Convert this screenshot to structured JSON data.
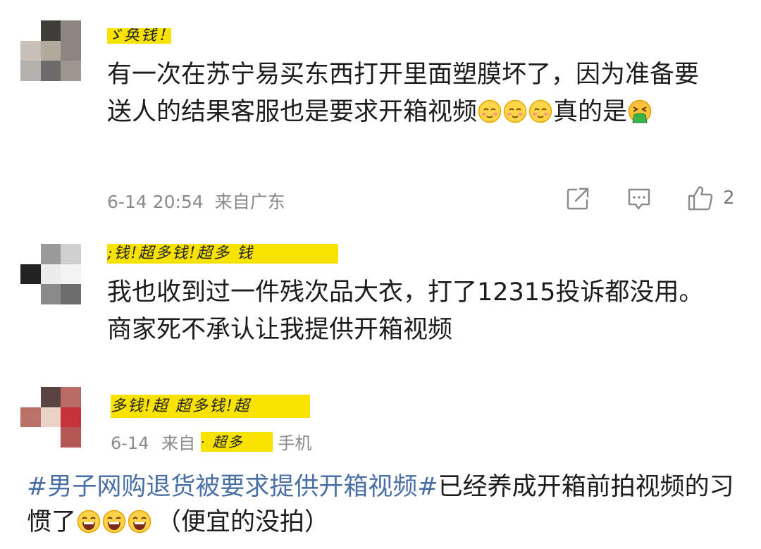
{
  "comments": [
    {
      "avatar_colors": [
        "#ffffff",
        "#3f3e3b",
        "#8f8580",
        "#c9bfb6",
        "#b3aa9e",
        "#8f8580",
        "#b4b0ad",
        "#6c6a6a",
        "#a1968f"
      ],
      "text": "有一次在苏宁易买东西打开里面塑膜坏了，因为准备要送人的结果客服也是要求开箱视频",
      "text_tail": "真的是",
      "timestamp": "6-14 20:54",
      "location": "来自广东",
      "like_count": "2",
      "emoji_after_text": [
        "blushing-face",
        "blushing-face",
        "blushing-face"
      ],
      "emoji_end": "vomiting-face"
    },
    {
      "avatar_colors": [
        "#ffffff",
        "#9a9a9a",
        "#cfcfcf",
        "#222222",
        "#ececec",
        "#f3f3f3",
        "#ffffff",
        "#8a8a8a",
        "#6d6d6d"
      ],
      "text": "我也收到过一件残次品大衣，打了12315投诉都没用。商家死不承认让我提供开箱视频"
    },
    {
      "avatar_colors": [
        "#ffffff",
        "#5a4340",
        "#b76c66",
        "#b97168",
        "#ead2c6",
        "#c6323a",
        "#ffffff",
        "#ffffff",
        "#b55754"
      ],
      "timestamp": "6-14",
      "location_prefix": "来自",
      "location_suffix": "手机"
    }
  ],
  "caption": {
    "hashtag": "#男子网购退货被要求提供开箱视频#",
    "text": "已经养成开箱前拍视频的习惯了",
    "emoji": [
      "laughing-face",
      "laughing-face",
      "laughing-face"
    ],
    "tail": "（便宜的没拍）"
  },
  "icons": {
    "share": "share-icon",
    "comment": "comment-icon",
    "like": "thumbs-up-icon"
  }
}
